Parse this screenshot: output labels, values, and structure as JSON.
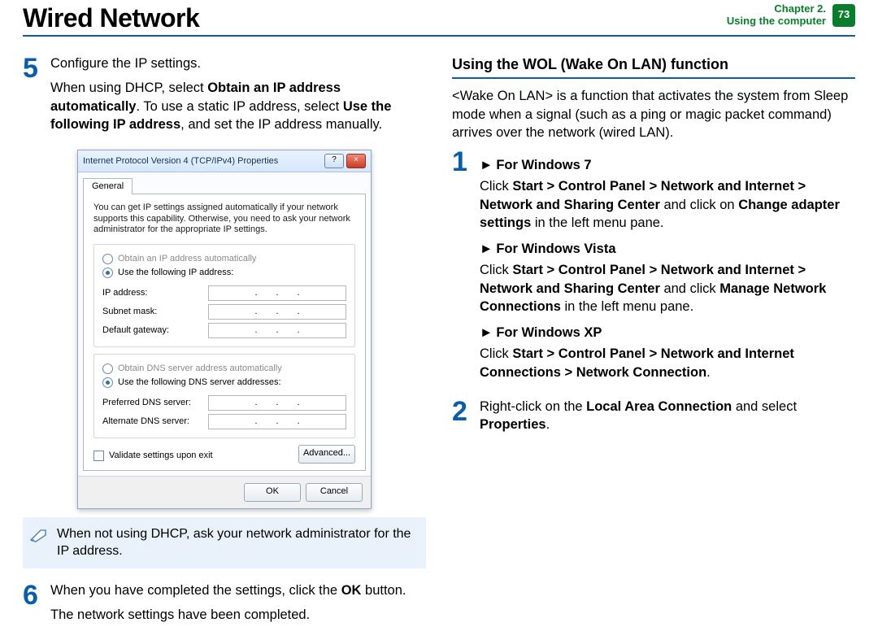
{
  "header": {
    "title": "Wired Network",
    "chapter_line1": "Chapter 2.",
    "chapter_line2": "Using the computer",
    "page_number": "73"
  },
  "left": {
    "step5": {
      "num": "5",
      "line1": "Configure the IP settings.",
      "line2_pre": "When using DHCP, select ",
      "line2_b1": "Obtain an IP address automatically",
      "line2_mid": ". To use a static IP address, select ",
      "line2_b2": "Use the following IP address",
      "line2_end": ", and set the IP address manually."
    },
    "dialog": {
      "title": "Internet Protocol Version 4 (TCP/IPv4) Properties",
      "help": "?",
      "close": "×",
      "tab": "General",
      "desc": "You can get IP settings assigned automatically if your network supports this capability. Otherwise, you need to ask your network administrator for the appropriate IP settings.",
      "radio_auto_ip": "Obtain an IP address automatically",
      "radio_use_ip": "Use the following IP address:",
      "lbl_ip": "IP address:",
      "lbl_mask": "Subnet mask:",
      "lbl_gw": "Default gateway:",
      "radio_auto_dns": "Obtain DNS server address automatically",
      "radio_use_dns": "Use the following DNS server addresses:",
      "lbl_pdns": "Preferred DNS server:",
      "lbl_adns": "Alternate DNS server:",
      "validate": "Validate settings upon exit",
      "btn_adv": "Advanced...",
      "btn_ok": "OK",
      "btn_cancel": "Cancel"
    },
    "note": "When not using DHCP, ask your network administrator for the IP address.",
    "step6": {
      "num": "6",
      "line1_pre": "When you have completed the settings, click the ",
      "line1_b": "OK",
      "line1_end": " button.",
      "line2": "The network settings have been completed."
    }
  },
  "right": {
    "section_title": "Using the WOL (Wake On LAN) function",
    "intro": "<Wake On LAN> is a function that activates the system from Sleep mode when a signal (such as a ping or magic packet command) arrives over the network (wired LAN).",
    "step1": {
      "num": "1",
      "w7_head": "For Windows 7",
      "w7_pre": "Click ",
      "w7_b1": "Start > Control Panel > Network and Internet > Network and Sharing Center",
      "w7_mid": " and click on ",
      "w7_b2": "Change adapter settings",
      "w7_end": " in the left menu pane.",
      "vista_head": "For Windows Vista",
      "vista_pre": "Click ",
      "vista_b1": "Start > Control Panel > Network and Internet > Network and Sharing Center",
      "vista_mid": " and click ",
      "vista_b2": "Manage Network Connections",
      "vista_end": " in the left menu pane.",
      "xp_head": "For Windows XP",
      "xp_pre": "Click ",
      "xp_b1": "Start > Control Panel > Network and Internet Connections > Network Connection",
      "xp_end": "."
    },
    "step2": {
      "num": "2",
      "pre": "Right-click on the ",
      "b1": "Local Area Connection",
      "mid": " and select ",
      "b2": "Properties",
      "end": "."
    }
  }
}
